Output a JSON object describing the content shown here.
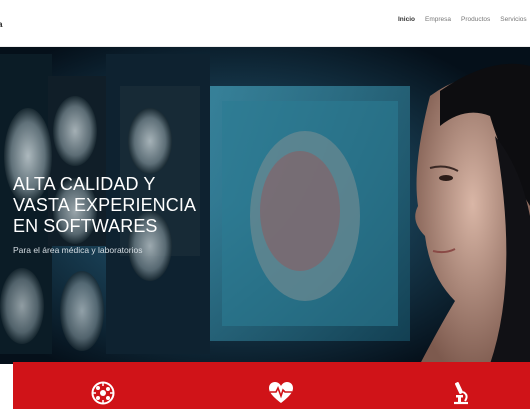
{
  "header": {
    "logo_text": "a",
    "nav": [
      {
        "label": "Inicio",
        "active": true
      },
      {
        "label": "Empresa",
        "active": false
      },
      {
        "label": "Productos",
        "active": false
      },
      {
        "label": "Servicios",
        "active": false
      }
    ]
  },
  "hero": {
    "title_lines": [
      "ALTA CALIDAD Y",
      "VASTA EXPERIENCIA",
      "EN SOFTWARES"
    ],
    "subtitle": "Para el área médica y laboratorios"
  },
  "features": {
    "background": "#d01318",
    "icons": [
      "virus-icon",
      "heartbeat-icon",
      "microscope-icon"
    ]
  }
}
